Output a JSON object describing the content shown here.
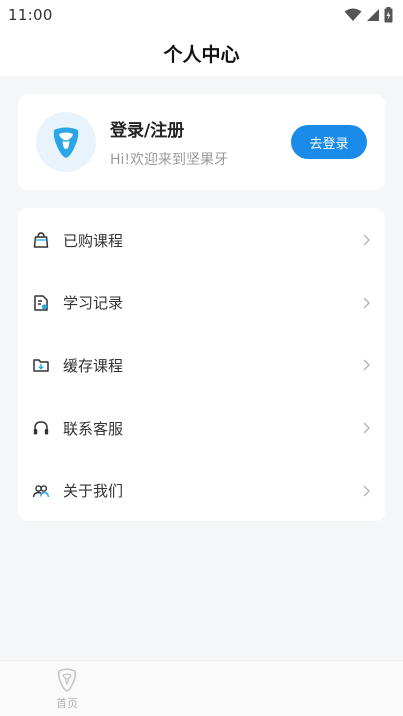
{
  "status_bar": {
    "time": "11:00",
    "icons": [
      "wifi-icon",
      "signal-icon",
      "battery-icon"
    ]
  },
  "header": {
    "title": "个人中心"
  },
  "profile": {
    "title": "登录/注册",
    "subtitle": "Hi!欢迎来到坚果牙",
    "login_button": "去登录",
    "avatar_icon": "tooth-logo-icon"
  },
  "menu": {
    "items": [
      {
        "label": "已购课程",
        "icon": "shopping-bag-icon"
      },
      {
        "label": "学习记录",
        "icon": "study-record-icon"
      },
      {
        "label": "缓存课程",
        "icon": "download-folder-icon"
      },
      {
        "label": "联系客服",
        "icon": "headphones-icon"
      },
      {
        "label": "关于我们",
        "icon": "people-icon"
      }
    ]
  },
  "tabbar": {
    "home_label": "首页"
  },
  "colors": {
    "accent": "#1a8be8",
    "background": "#f5f6f8",
    "card": "#ffffff"
  }
}
